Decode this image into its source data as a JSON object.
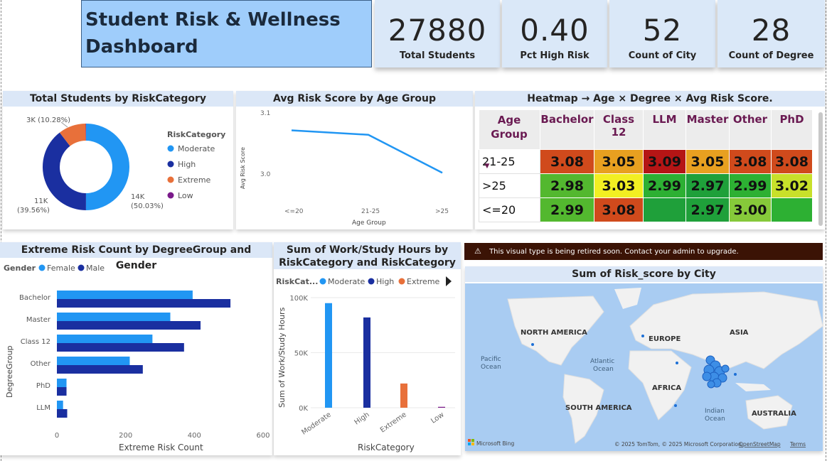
{
  "dashboard": {
    "title_line1": "Student Risk & Wellness",
    "title_line2": "Dashboard"
  },
  "kpis": [
    {
      "value": "27880",
      "label": "Total Students"
    },
    {
      "value": "0.40",
      "label": "Pct High Risk"
    },
    {
      "value": "52",
      "label": "Count of City"
    },
    {
      "value": "28",
      "label": "Count of Degree"
    }
  ],
  "colors": {
    "moderate": "#2196f3",
    "high": "#1a2fa0",
    "extreme": "#e8703a",
    "low": "#7a1a8a",
    "female": "#2196f3",
    "male": "#1a2fa0",
    "header_bg": "#dbe7f7"
  },
  "donut": {
    "title": "Total Students by RiskCategory",
    "legend_title": "RiskCategory",
    "legend": [
      "Moderate",
      "High",
      "Extreme",
      "Low"
    ],
    "label_extreme": "3K (10.28%)",
    "label_high_1": "11K",
    "label_high_2": "(39.56%)",
    "label_moderate_1": "14K",
    "label_moderate_2": "(50.03%)",
    "chart_data": {
      "type": "pie",
      "categories": [
        "Moderate",
        "High",
        "Extreme",
        "Low"
      ],
      "values": [
        50.03,
        39.56,
        10.28,
        0.13
      ]
    }
  },
  "line": {
    "title": "Avg Risk Score by Age Group",
    "ylabel": "Avg Risk Score",
    "xlabel": "Age Group",
    "y_ticks": [
      "3.1",
      "3.0"
    ],
    "chart_data": {
      "type": "line",
      "categories": [
        "<=20",
        "21-25",
        ">25"
      ],
      "values": [
        3.079,
        3.069,
        2.983
      ],
      "ylim": [
        2.94,
        3.12
      ]
    }
  },
  "heatmap": {
    "title": "Heatmap → Age × Degree × Avg Risk Score.",
    "corner_header": "Age Group",
    "sort_icon": "sort-descending-icon",
    "columns": [
      "Bachelor",
      "Class 12",
      "LLM",
      "Master",
      "Other",
      "PhD"
    ],
    "rows": [
      {
        "label": "21-25",
        "cells": [
          "3.08",
          "3.05",
          "3.09",
          "3.05",
          "3.08",
          "3.08"
        ],
        "colors": [
          "#d04a1c",
          "#e8a020",
          "#b51515",
          "#e8a020",
          "#d04a1c",
          "#d04a1c"
        ]
      },
      {
        "label": ">25",
        "cells": [
          "2.98",
          "3.03",
          "2.99",
          "2.97",
          "2.99",
          "3.02"
        ],
        "colors": [
          "#53b82f",
          "#f2ef22",
          "#2db033",
          "#1fa03a",
          "#2db033",
          "#c8e02a"
        ]
      },
      {
        "label": "<=20",
        "cells": [
          "2.99",
          "3.08",
          "",
          "2.97",
          "3.00",
          ""
        ],
        "colors": [
          "#53b82f",
          "#d04a1c",
          "#1fa03a",
          "#1fa03a",
          "#86c93a",
          "#2db033"
        ]
      }
    ]
  },
  "hbar": {
    "title": "Extreme Risk Count by DegreeGroup and Gender",
    "legend_title": "Gender",
    "legend": [
      "Female",
      "Male"
    ],
    "ylabel": "DegreeGroup",
    "xlabel": "Extreme Risk Count",
    "x_ticks": [
      "0",
      "200",
      "400",
      "600"
    ],
    "chart_data": {
      "type": "bar",
      "categories": [
        "Bachelor",
        "Master",
        "Class 12",
        "Other",
        "PhD",
        "LLM"
      ],
      "series": [
        {
          "name": "Female",
          "values": [
            395,
            330,
            278,
            212,
            28,
            18
          ]
        },
        {
          "name": "Male",
          "values": [
            505,
            418,
            370,
            250,
            28,
            30
          ]
        }
      ],
      "xlim": [
        0,
        600
      ]
    }
  },
  "columns": {
    "title_line1": "Sum of Work/Study Hours by",
    "title_line2": "RiskCategory and RiskCategory",
    "legend_title": "RiskCat...",
    "legend": [
      "Moderate",
      "High",
      "Extreme"
    ],
    "ylabel": "Sum of Work/Study Hours",
    "xlabel": "RiskCategory",
    "y_ticks": [
      "100K",
      "50K",
      "0K"
    ],
    "chart_data": {
      "type": "bar",
      "categories": [
        "Moderate",
        "High",
        "Extreme",
        "Low"
      ],
      "values": [
        95000,
        82000,
        22000,
        800
      ],
      "ylim": [
        0,
        100000
      ]
    }
  },
  "warning": {
    "icon": "warning-icon",
    "text": "This visual type is being retired soon. Contact your admin to upgrade."
  },
  "map": {
    "title": "Sum of Risk_score by City",
    "labels": {
      "north_america": "NORTH AMERICA",
      "europe": "EUROPE",
      "asia": "ASIA",
      "pacific": "Pacific",
      "pacific2": "Ocean",
      "atlantic": "Atlantic",
      "atlantic2": "Ocean",
      "africa": "AFRICA",
      "south_america": "SOUTH AMERICA",
      "indian": "Indian",
      "indian2": "Ocean",
      "australia": "AUSTRALIA"
    },
    "attribution": "© 2025 TomTom, © 2025 Microsoft Corporation,",
    "osm": "OpenStreetMap",
    "terms": "Terms",
    "bing": "Microsoft Bing"
  }
}
